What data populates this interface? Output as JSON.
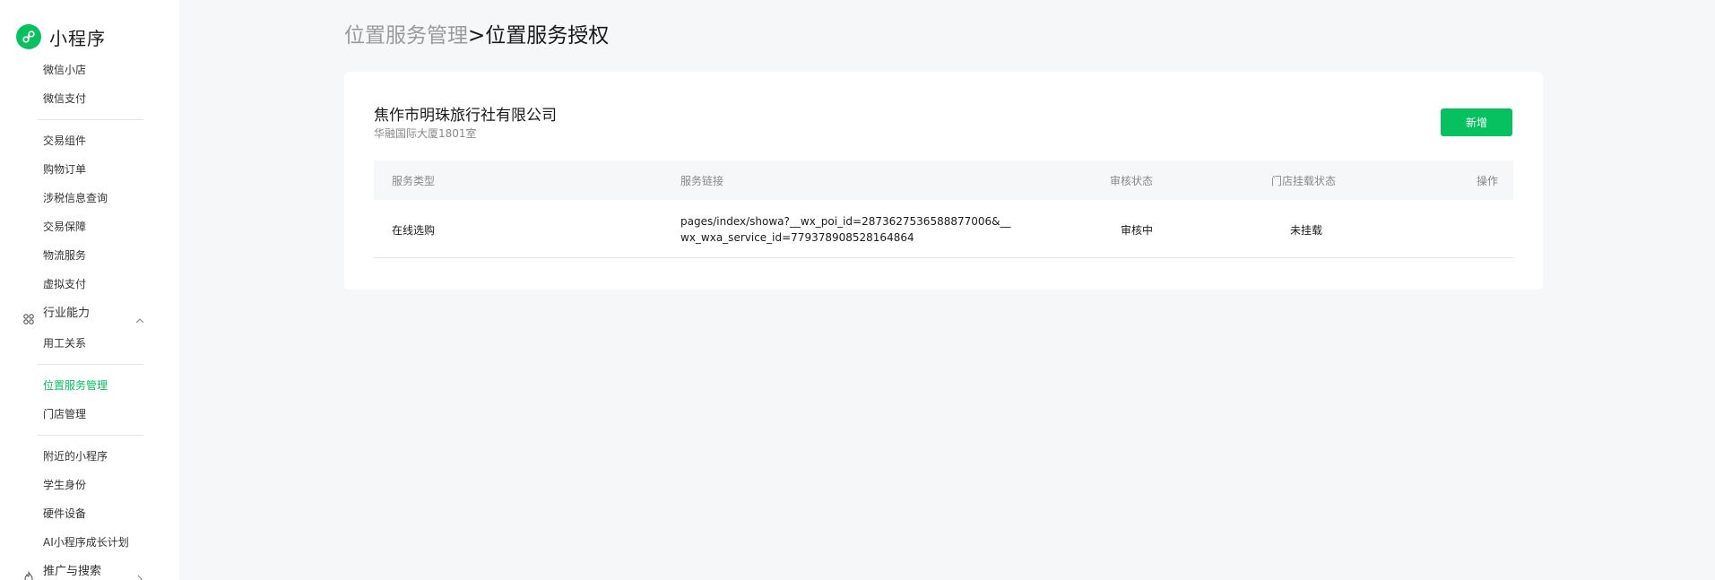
{
  "sidebar": {
    "brand": "小程序",
    "items": [
      {
        "type": "item",
        "label": "微信小店"
      },
      {
        "type": "item",
        "label": "微信支付"
      },
      {
        "type": "divider"
      },
      {
        "type": "item",
        "label": "交易组件"
      },
      {
        "type": "item",
        "label": "购物订单"
      },
      {
        "type": "item",
        "label": "涉税信息查询"
      },
      {
        "type": "item",
        "label": "交易保障"
      },
      {
        "type": "item",
        "label": "物流服务"
      },
      {
        "type": "item",
        "label": "虚拟支付"
      },
      {
        "type": "group",
        "label": "行业能力",
        "icon": "industry-icon",
        "chevron": "up"
      },
      {
        "type": "item",
        "label": "用工关系"
      },
      {
        "type": "divider"
      },
      {
        "type": "item",
        "label": "位置服务管理",
        "active": true
      },
      {
        "type": "item",
        "label": "门店管理"
      },
      {
        "type": "divider"
      },
      {
        "type": "item",
        "label": "附近的小程序"
      },
      {
        "type": "item",
        "label": "学生身份"
      },
      {
        "type": "item",
        "label": "硬件设备"
      },
      {
        "type": "item",
        "label": "AI小程序成长计划"
      },
      {
        "type": "group",
        "label": "推广与搜索",
        "icon": "flame-icon",
        "chevron": "right"
      }
    ]
  },
  "header": {
    "breadcrumb_parent": "位置服务管理",
    "separator": ">",
    "current": "位置服务授权"
  },
  "store": {
    "name": "焦作市明珠旅行社有限公司",
    "address": "华融国际大厦1801室",
    "add_button": "新增"
  },
  "table": {
    "columns": [
      "服务类型",
      "服务链接",
      "审核状态",
      "门店挂载状态",
      "操作"
    ],
    "rows": [
      {
        "service_type": "在线选购",
        "link": "pages/index/showa?__wx_poi_id=2873627536588877006&__wx_wxa_service_id=779378908528164864",
        "review_status": "审核中",
        "mount_status": "未挂载",
        "action": ""
      }
    ]
  },
  "colors": {
    "accent": "#07c160",
    "background": "#f6f7f9",
    "muted_text": "#888888"
  }
}
